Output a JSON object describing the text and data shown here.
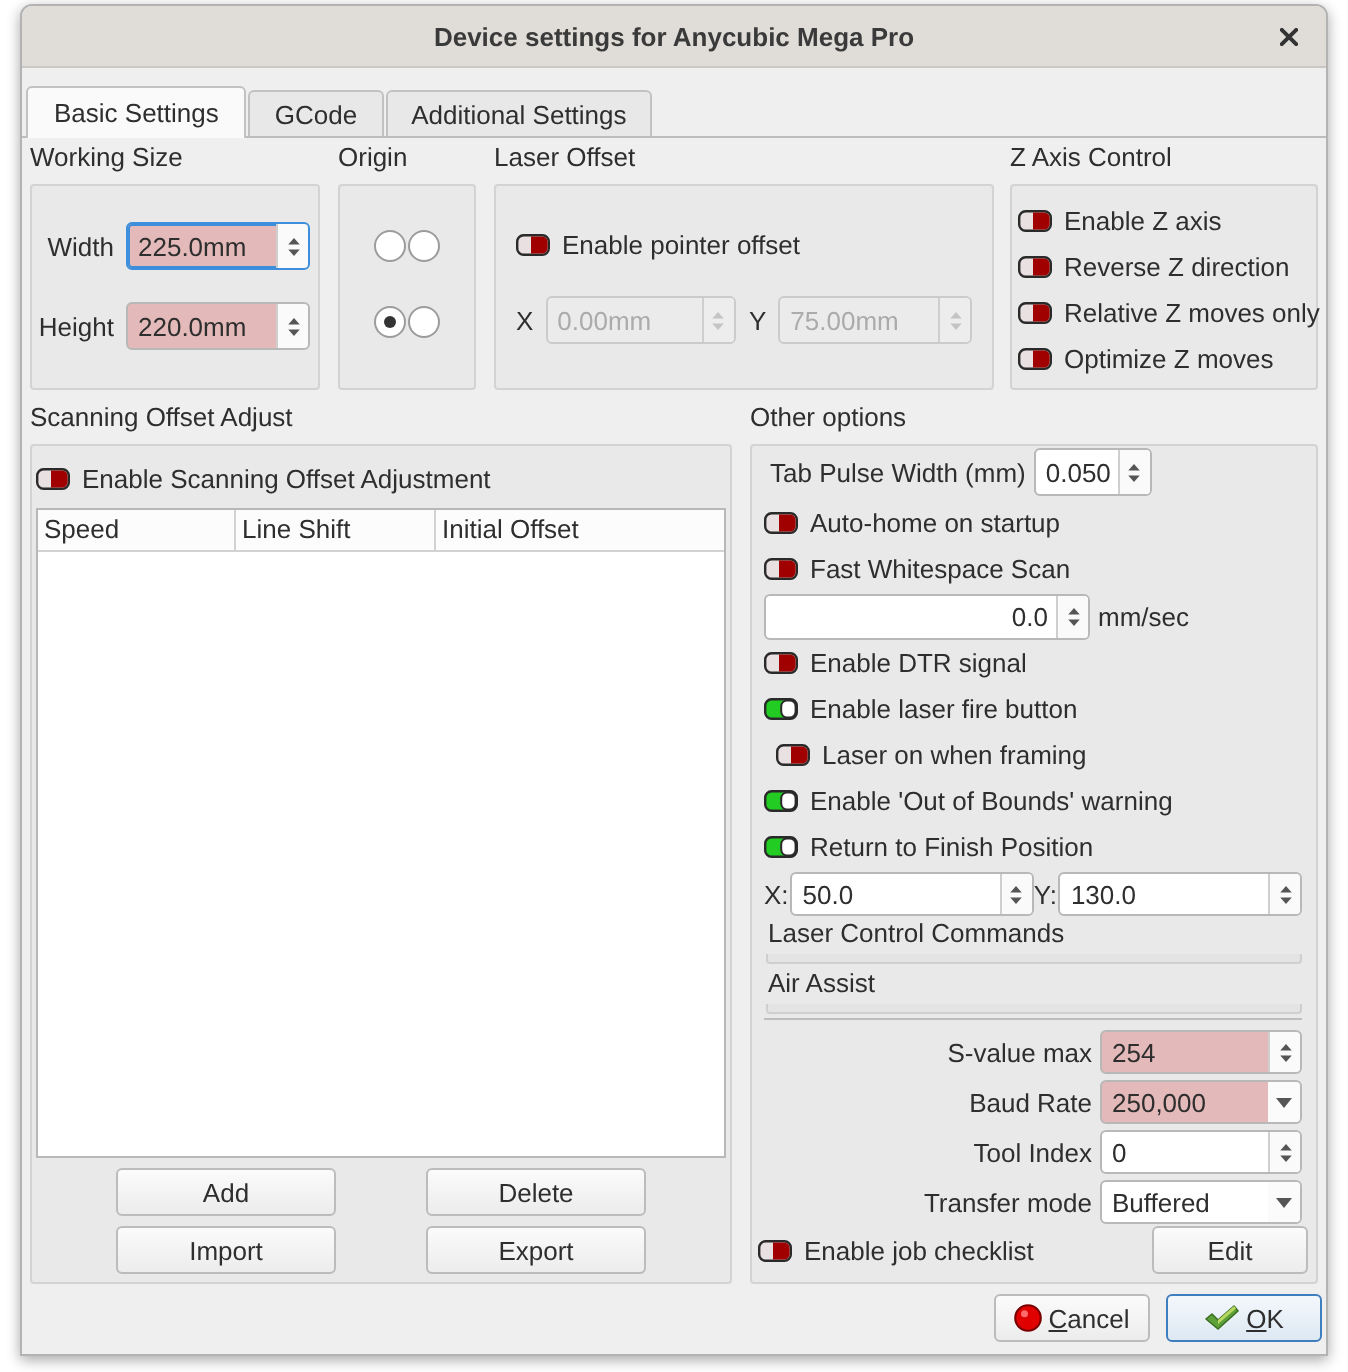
{
  "window": {
    "title": "Device settings for Anycubic Mega Pro"
  },
  "tabs": [
    {
      "label": "Basic Settings",
      "selected": true
    },
    {
      "label": "GCode",
      "selected": false
    },
    {
      "label": "Additional Settings",
      "selected": false
    }
  ],
  "working_size": {
    "title": "Working Size",
    "fields": [
      {
        "label": "Width",
        "value": "225.0mm",
        "highlighted": true,
        "focused": true
      },
      {
        "label": "Height",
        "value": "220.0mm",
        "highlighted": true,
        "focused": false
      }
    ]
  },
  "origin": {
    "title": "Origin",
    "radios": [
      {
        "selected": false
      },
      {
        "selected": false
      },
      {
        "selected": true
      },
      {
        "selected": false
      }
    ]
  },
  "laser_offset": {
    "title": "Laser Offset",
    "toggle": {
      "label": "Enable pointer offset",
      "on": false
    },
    "fields": [
      {
        "label": "X",
        "value": "0.00mm",
        "disabled": true
      },
      {
        "label": "Y",
        "value": "75.00mm",
        "disabled": true
      }
    ]
  },
  "z_axis": {
    "title": "Z Axis Control",
    "toggles": [
      {
        "label": "Enable Z axis",
        "on": false
      },
      {
        "label": "Reverse Z direction",
        "on": false
      },
      {
        "label": "Relative Z moves only",
        "on": false
      },
      {
        "label": "Optimize Z moves",
        "on": false
      }
    ]
  },
  "scanning_offset": {
    "title": "Scanning Offset Adjust",
    "toggle": {
      "label": "Enable Scanning Offset Adjustment",
      "on": false
    },
    "table": {
      "columns": [
        "Speed",
        "Line Shift",
        "Initial Offset"
      ]
    },
    "buttons": [
      "Add",
      "Delete",
      "Import",
      "Export"
    ]
  },
  "other_options": {
    "title": "Other options",
    "rows": [
      {
        "kind": "spin",
        "label": "Tab Pulse Width (mm)",
        "value": "0.050"
      },
      {
        "kind": "toggle",
        "label": "Auto-home on startup",
        "on": false
      },
      {
        "kind": "toggle",
        "label": "Fast Whitespace Scan",
        "on": false
      },
      {
        "kind": "speed",
        "value": "0.0",
        "unit": "mm/sec"
      },
      {
        "kind": "toggle",
        "label": "Enable DTR signal",
        "on": false
      },
      {
        "kind": "toggle",
        "label": "Enable laser fire button",
        "on": true,
        "children": [
          {
            "label": "Laser on when framing",
            "on": false
          }
        ]
      },
      {
        "kind": "toggle",
        "label": "Enable 'Out of Bounds' warning",
        "on": true
      },
      {
        "kind": "toggle",
        "label": "Return to Finish Position",
        "on": true
      },
      {
        "kind": "xy",
        "x_label": "X:",
        "x_value": "50.0",
        "y_label": "Y:",
        "y_value": "130.0"
      },
      {
        "kind": "section",
        "label": "Laser Control Commands"
      },
      {
        "kind": "section",
        "label": "Air Assist"
      }
    ],
    "form": [
      {
        "kind": "spin",
        "label": "S-value max",
        "value": "254",
        "highlighted": true
      },
      {
        "kind": "combo",
        "label": "Baud Rate",
        "value": "250,000",
        "highlighted": true
      },
      {
        "kind": "spin",
        "label": "Tool Index",
        "value": "0",
        "highlighted": false
      },
      {
        "kind": "combo",
        "label": "Transfer mode",
        "value": "Buffered",
        "highlighted": false
      }
    ],
    "checklist": {
      "label": "Enable job checklist",
      "on": false,
      "button": "Edit"
    }
  },
  "dialog_buttons": [
    {
      "kind": "cancel",
      "label": "Cancel",
      "underline_first": true,
      "default": false
    },
    {
      "kind": "ok",
      "label": "OK",
      "underline_first": true,
      "default": true
    }
  ]
}
